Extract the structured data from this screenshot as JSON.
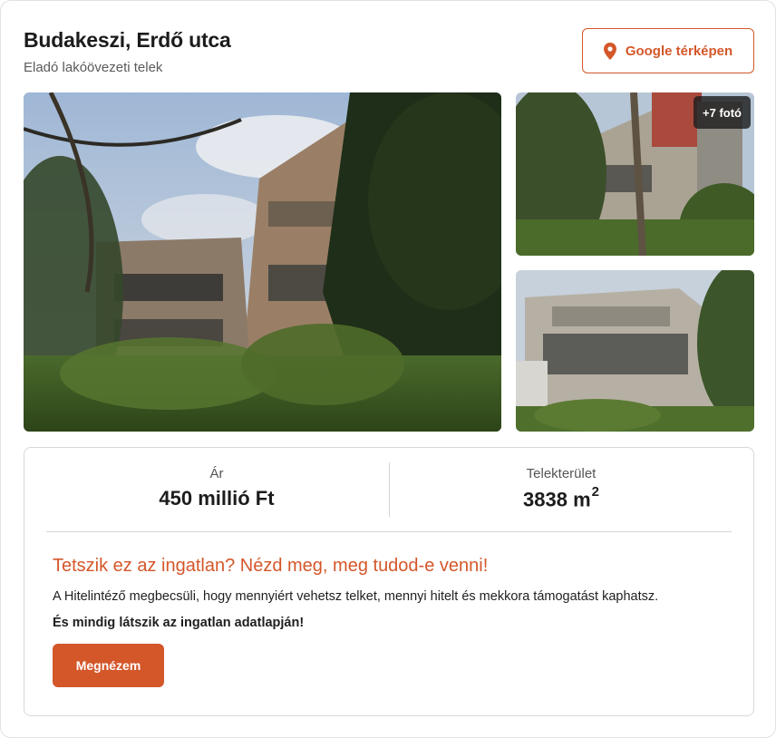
{
  "listing": {
    "title": "Budakeszi, Erdő utca",
    "subtitle": "Eladó lakóövezeti telek"
  },
  "map_button": {
    "label": "Google térképen",
    "icon": "map-pin-icon"
  },
  "gallery": {
    "more_photos_label": "+7 fotó"
  },
  "stats": {
    "price": {
      "label": "Ár",
      "value": "450 millió Ft"
    },
    "area": {
      "label": "Telekterület",
      "value": "3838 m",
      "unit_sup": "2"
    }
  },
  "promo": {
    "title": "Tetszik ez az ingatlan? Nézd meg, meg tudod-e venni!",
    "text": "A Hitelintéző megbecsüli, hogy mennyiért vehetsz telket, mennyi hitelt és mekkora támogatást kaphatsz.",
    "bold_text": "És mindig látszik az ingatlan adatlapján!",
    "button_label": "Megnézem"
  },
  "colors": {
    "accent": "#d4572a",
    "text": "#1c1c1c",
    "muted": "#5a5a5a",
    "border": "#d8d8d8"
  }
}
